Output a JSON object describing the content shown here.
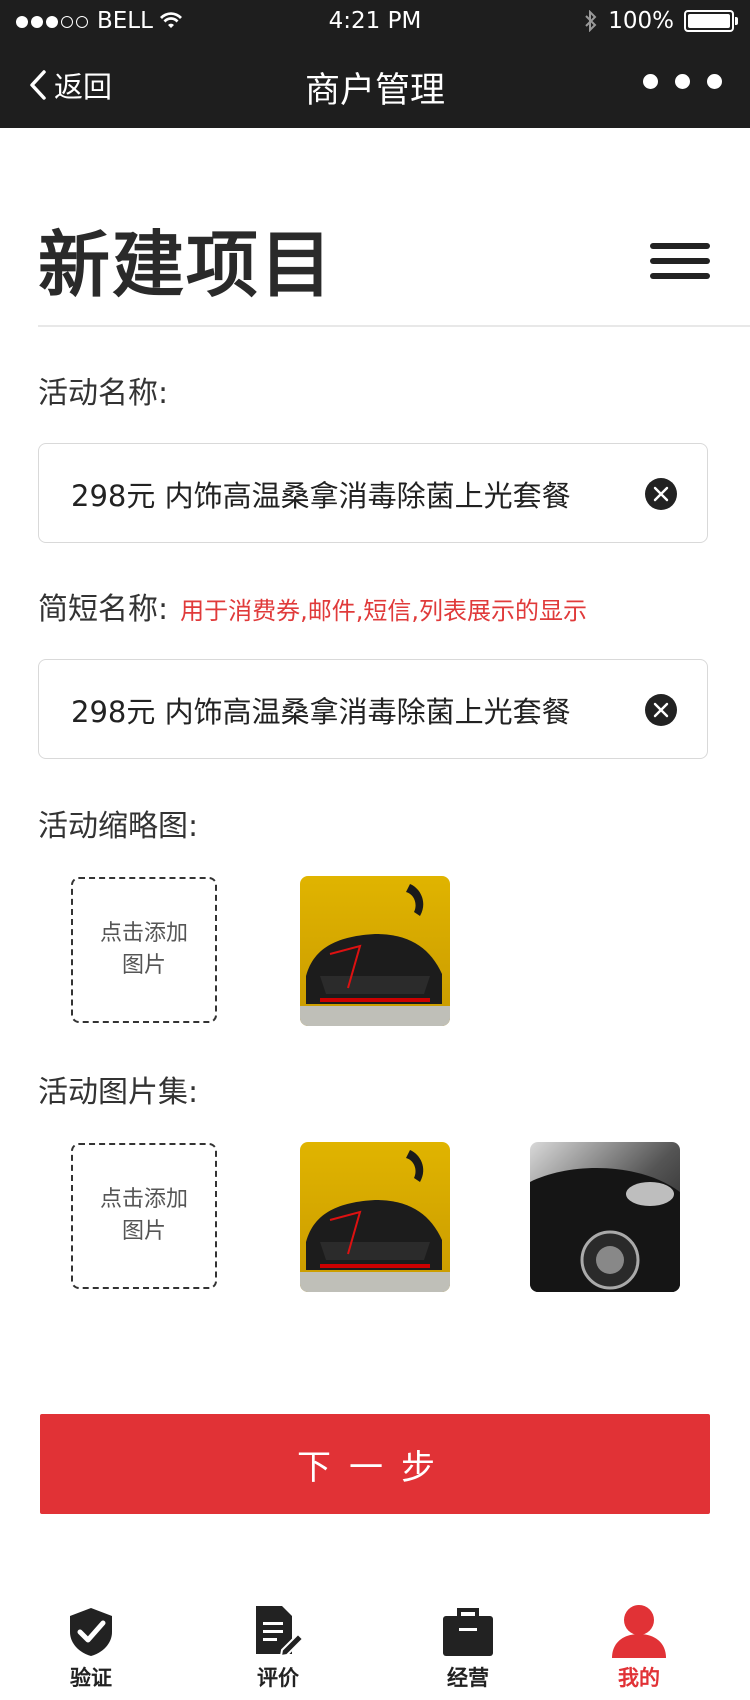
{
  "status_bar": {
    "carrier": "BELL",
    "time": "4:21 PM",
    "battery": "100%"
  },
  "nav": {
    "back_label": "返回",
    "title": "商户管理"
  },
  "page": {
    "title": "新建项目"
  },
  "form": {
    "activity_name": {
      "label": "活动名称:",
      "value": "298元 内饰高温桑拿消毒除菌上光套餐"
    },
    "short_name": {
      "label": "简短名称:",
      "hint": "用于消费券,邮件,短信,列表展示的显示",
      "value": "298元 内饰高温桑拿消毒除菌上光套餐"
    },
    "thumbnail": {
      "label": "活动缩略图:",
      "add_label_line1": "点击添加",
      "add_label_line2": "图片"
    },
    "gallery": {
      "label": "活动图片集:",
      "add_label_line1": "点击添加",
      "add_label_line2": "图片"
    }
  },
  "next_button": "下一步",
  "tabs": [
    {
      "label": "验证",
      "icon": "shield-check-icon",
      "active": false
    },
    {
      "label": "评价",
      "icon": "document-edit-icon",
      "active": false
    },
    {
      "label": "经营",
      "icon": "briefcase-icon",
      "active": false
    },
    {
      "label": "我的",
      "icon": "user-icon",
      "active": true
    }
  ],
  "colors": {
    "accent": "#e13236",
    "topbar": "#1e1e1e",
    "hint": "#e03a3a"
  }
}
